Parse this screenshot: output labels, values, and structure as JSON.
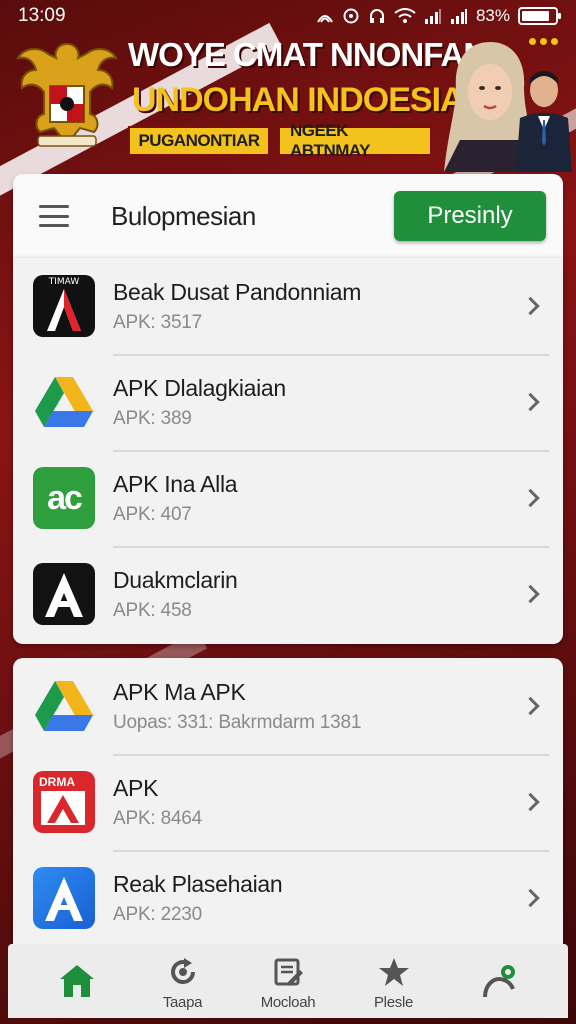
{
  "status_bar": {
    "time": "13:09",
    "battery_text": "83%",
    "battery_level": 0.83,
    "icons": [
      "nfc-icon",
      "sync-icon",
      "headphone-icon",
      "wifi-icon",
      "signal-icon",
      "signal-icon",
      "battery-icon"
    ]
  },
  "banner": {
    "title": "WOYE CMAT NNONFAN",
    "subtitle": "UNDOHAN INDOESIA",
    "button_1": "PUGANONTIAR",
    "button_2": "NGEEK ABTNMAY",
    "colors": {
      "title": "#ffffff",
      "subtitle": "#f3c21d",
      "buttons": "#f4c21c"
    }
  },
  "app_bar": {
    "title": "Bulopmesian",
    "primary_button": "Presinly",
    "accent": "#1f8f3b"
  },
  "list_1": [
    {
      "name": "Beak Dusat Pandonniam",
      "meta": "APK: 3517",
      "icon": "letter-a-dark-icon",
      "icon_caption": "TIMAW"
    },
    {
      "name": "APK Dlalagkiaian",
      "meta": "APK: 389",
      "icon": "drive-triangle-icon"
    },
    {
      "name": "APK Ina Alla",
      "meta": "APK: 407",
      "icon": "green-ac-icon",
      "icon_caption": "ac"
    },
    {
      "name": "Duakmclarin",
      "meta": "APK: 458",
      "icon": "letter-a-black-icon"
    }
  ],
  "list_2": [
    {
      "name": "APK Ma APK",
      "meta": "Uopas: 331: Bakrmdarm 1381",
      "icon": "drive-triangle-icon"
    },
    {
      "name": "APK",
      "meta": "APK: 8464",
      "icon": "red-letter-a-icon",
      "icon_caption": "DRMA"
    },
    {
      "name": "Reak Plasehaian",
      "meta": "APK: 2230",
      "icon": "blue-letter-a-icon"
    }
  ],
  "bottom_nav": [
    {
      "label": "",
      "icon": "home-icon",
      "active": true
    },
    {
      "label": "Taapa",
      "icon": "refresh-icon"
    },
    {
      "label": "Mocloah",
      "icon": "document-icon"
    },
    {
      "label": "Plesle",
      "icon": "star-icon"
    },
    {
      "label": "",
      "icon": "profile-pin-icon"
    }
  ]
}
